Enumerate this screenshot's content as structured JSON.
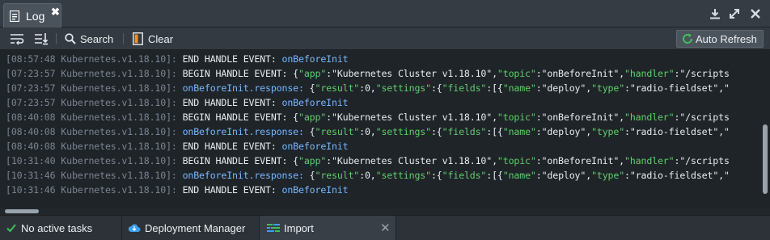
{
  "tab": {
    "label": "Log",
    "close": "✖"
  },
  "toolbar": {
    "search_label": "Search",
    "clear_label": "Clear",
    "auto_refresh_label": "Auto Refresh"
  },
  "log_lines": [
    [
      [
        "[08:57:48 Kubernetes.v1.18.10]: ",
        "ts"
      ],
      [
        "END HANDLE EVENT: ",
        "w"
      ],
      [
        "onBeforeInit",
        "b"
      ]
    ],
    [
      [
        "[07:23:57 Kubernetes.v1.18.10]: ",
        "ts"
      ],
      [
        "BEGIN HANDLE EVENT: ",
        "w"
      ],
      [
        "{",
        "w"
      ],
      [
        "\"app\"",
        "g"
      ],
      [
        ":\"Kubernetes Cluster v1.18.10\",",
        "w"
      ],
      [
        "\"topic\"",
        "g"
      ],
      [
        ":\"onBeforeInit\",",
        "w"
      ],
      [
        "\"handler\"",
        "g"
      ],
      [
        ":\"/scripts",
        "w"
      ]
    ],
    [
      [
        "[07:23:57 Kubernetes.v1.18.10]: ",
        "ts"
      ],
      [
        "onBeforeInit.response: ",
        "b"
      ],
      [
        "{",
        "w"
      ],
      [
        "\"result\"",
        "g"
      ],
      [
        ":0,",
        "w"
      ],
      [
        "\"settings\"",
        "g"
      ],
      [
        ":{",
        "w"
      ],
      [
        "\"fields\"",
        "g"
      ],
      [
        ":[{",
        "w"
      ],
      [
        "\"name\"",
        "g"
      ],
      [
        ":\"deploy\",",
        "w"
      ],
      [
        "\"type\"",
        "g"
      ],
      [
        ":\"radio-fieldset\",\"",
        "w"
      ]
    ],
    [
      [
        "[07:23:57 Kubernetes.v1.18.10]: ",
        "ts"
      ],
      [
        "END HANDLE EVENT: ",
        "w"
      ],
      [
        "onBeforeInit",
        "b"
      ]
    ],
    [
      [
        "[08:40:08 Kubernetes.v1.18.10]: ",
        "ts"
      ],
      [
        "BEGIN HANDLE EVENT: ",
        "w"
      ],
      [
        "{",
        "w"
      ],
      [
        "\"app\"",
        "g"
      ],
      [
        ":\"Kubernetes Cluster v1.18.10\",",
        "w"
      ],
      [
        "\"topic\"",
        "g"
      ],
      [
        ":\"onBeforeInit\",",
        "w"
      ],
      [
        "\"handler\"",
        "g"
      ],
      [
        ":\"/scripts",
        "w"
      ]
    ],
    [
      [
        "[08:40:08 Kubernetes.v1.18.10]: ",
        "ts"
      ],
      [
        "onBeforeInit.response: ",
        "b"
      ],
      [
        "{",
        "w"
      ],
      [
        "\"result\"",
        "g"
      ],
      [
        ":0,",
        "w"
      ],
      [
        "\"settings\"",
        "g"
      ],
      [
        ":{",
        "w"
      ],
      [
        "\"fields\"",
        "g"
      ],
      [
        ":[{",
        "w"
      ],
      [
        "\"name\"",
        "g"
      ],
      [
        ":\"deploy\",",
        "w"
      ],
      [
        "\"type\"",
        "g"
      ],
      [
        ":\"radio-fieldset\",\"",
        "w"
      ]
    ],
    [
      [
        "[08:40:08 Kubernetes.v1.18.10]: ",
        "ts"
      ],
      [
        "END HANDLE EVENT: ",
        "w"
      ],
      [
        "onBeforeInit",
        "b"
      ]
    ],
    [
      [
        "[10:31:40 Kubernetes.v1.18.10]: ",
        "ts"
      ],
      [
        "BEGIN HANDLE EVENT: ",
        "w"
      ],
      [
        "{",
        "w"
      ],
      [
        "\"app\"",
        "g"
      ],
      [
        ":\"Kubernetes Cluster v1.18.10\",",
        "w"
      ],
      [
        "\"topic\"",
        "g"
      ],
      [
        ":\"onBeforeInit\",",
        "w"
      ],
      [
        "\"handler\"",
        "g"
      ],
      [
        ":\"/scripts",
        "w"
      ]
    ],
    [
      [
        "[10:31:46 Kubernetes.v1.18.10]: ",
        "ts"
      ],
      [
        "onBeforeInit.response: ",
        "b"
      ],
      [
        "{",
        "w"
      ],
      [
        "\"result\"",
        "g"
      ],
      [
        ":0,",
        "w"
      ],
      [
        "\"settings\"",
        "g"
      ],
      [
        ":{",
        "w"
      ],
      [
        "\"fields\"",
        "g"
      ],
      [
        ":[{",
        "w"
      ],
      [
        "\"name\"",
        "g"
      ],
      [
        ":\"deploy\",",
        "w"
      ],
      [
        "\"type\"",
        "g"
      ],
      [
        ":\"radio-fieldset\",\"",
        "w"
      ]
    ],
    [
      [
        "[10:31:46 Kubernetes.v1.18.10]: ",
        "ts"
      ],
      [
        "END HANDLE EVENT: ",
        "w"
      ],
      [
        "onBeforeInit",
        "b"
      ]
    ]
  ],
  "status_bar": {
    "tasks_label": "No active tasks",
    "deployment_label": "Deployment Manager",
    "import_label": "Import",
    "import_close": "✕"
  },
  "colors": {
    "timestamp": "#7a8490",
    "keyword": "#e8ecef",
    "event": "#79b8ff",
    "json_key": "#5fcf6a",
    "check": "#3fbf5a",
    "refresh_icon": "#3fbf5a"
  },
  "icons": [
    "log-icon",
    "wrap-lines-icon",
    "scroll-bottom-icon",
    "search-icon",
    "clear-icon",
    "refresh-icon",
    "download-icon",
    "expand-icon",
    "close-icon",
    "check-icon",
    "cloud-icon",
    "import-icon"
  ]
}
